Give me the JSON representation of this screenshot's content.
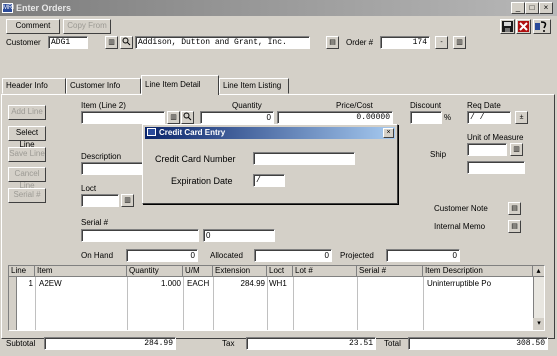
{
  "window": {
    "title": "Enter Orders",
    "app_icon": "MRI"
  },
  "toolbar": {
    "comment_label": "Comment",
    "copy_from_label": "Copy From"
  },
  "header": {
    "customer_label": "Customer",
    "customer_code": "ADG1",
    "customer_name": "Addison, Dutton and Grant, Inc.",
    "order_label": "Order #",
    "order_number": "174"
  },
  "tabs": [
    "Header Info",
    "Customer Info",
    "Line Item Detail",
    "Line Item Listing"
  ],
  "side_buttons": [
    "Add Line",
    "Select Line",
    "Save Line",
    "Cancel Line",
    "Serial #"
  ],
  "detail": {
    "item_label": "Item (Line 2)",
    "item_value": "",
    "quantity_label": "Quantity",
    "quantity_value": "0",
    "price_label": "Price/Cost",
    "price_value": "0.00000",
    "discount_label": "Discount",
    "discount_unit": "%",
    "req_date_label": "Req Date",
    "req_date_value": " /  / ",
    "description_label": "Description",
    "ship_label": "Ship",
    "uom_label": "Unit of Measure",
    "loct_label": "Loct",
    "serial_label": "Serial #",
    "serial_qty": "0",
    "customer_note_label": "Customer Note",
    "internal_memo_label": "Internal Memo",
    "on_hand_label": "On Hand",
    "on_hand_value": "0",
    "allocated_label": "Allocated",
    "allocated_value": "0",
    "projected_label": "Projected",
    "projected_value": "0"
  },
  "grid": {
    "columns": [
      "Line",
      "Item",
      "Quantity",
      "U/M",
      "Extension",
      "Loct",
      "Lot #",
      "Serial #",
      "Item Description"
    ],
    "rows": [
      {
        "line": "1",
        "item": "A2EW",
        "quantity": "1.000",
        "um": "EACH",
        "extension": "284.99",
        "loct": "WH1",
        "lot": "",
        "serial": "",
        "description": "Uninterruptible Po"
      }
    ]
  },
  "totals": {
    "subtotal_label": "Subtotal",
    "subtotal_value": "284.99",
    "tax_label": "Tax",
    "tax_value": "23.51",
    "total_label": "Total",
    "total_value": "308.50"
  },
  "dialog": {
    "title": "Credit Card Entry",
    "card_number_label": "Credit Card Number",
    "card_number_value": "",
    "expiration_label": "Expiration Date",
    "expiration_value": " / "
  },
  "colors": {
    "titlebar_inactive": "#8a8a8a",
    "dialog_titlebar": "#0a246a",
    "face": "#d4d0c8"
  }
}
